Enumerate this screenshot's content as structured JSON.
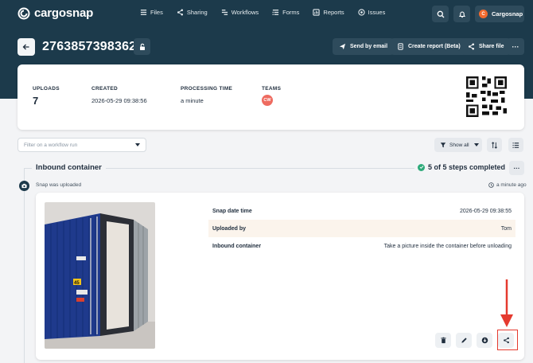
{
  "brand": {
    "name": "cargosnap"
  },
  "nav": [
    {
      "label": "Files",
      "icon": "list-icon"
    },
    {
      "label": "Sharing",
      "icon": "share-icon"
    },
    {
      "label": "Workflows",
      "icon": "workflow-icon"
    },
    {
      "label": "Forms",
      "icon": "forms-icon"
    },
    {
      "label": "Reports",
      "icon": "reports-icon"
    },
    {
      "label": "Issues",
      "icon": "issues-icon"
    }
  ],
  "user": {
    "name": "Cargosnap",
    "initial": "C"
  },
  "file": {
    "title": "2763857398362",
    "actions": {
      "send": "Send by email",
      "report": "Create report (Beta)",
      "share": "Share file"
    }
  },
  "stats": {
    "uploads_label": "UPLOADS",
    "uploads_value": "7",
    "created_label": "CREATED",
    "created_value": "2026-05-29 09:38:56",
    "processing_label": "PROCESSING TIME",
    "processing_value": "a minute",
    "teams_label": "TEAMS",
    "team_badge": "CW"
  },
  "filter": {
    "placeholder": "Filter on a workflow run",
    "show_all": "Show all"
  },
  "workflow": {
    "title": "Inbound container",
    "status": "5 of 5 steps completed"
  },
  "snap": {
    "event": "Snap was uploaded",
    "time_ago": "a minute ago",
    "rows": [
      {
        "key": "Snap date time",
        "value": "2026-05-29 09:38:55"
      },
      {
        "key": "Uploaded by",
        "value": "Tom"
      },
      {
        "key": "Inbound container",
        "value": "Take a picture inside the container before unloading"
      }
    ],
    "container_number": "45"
  },
  "colors": {
    "header": "#1c3a4b",
    "accent": "#f26a2e",
    "highlight": "#e53a2f",
    "success": "#2eaa7a"
  }
}
